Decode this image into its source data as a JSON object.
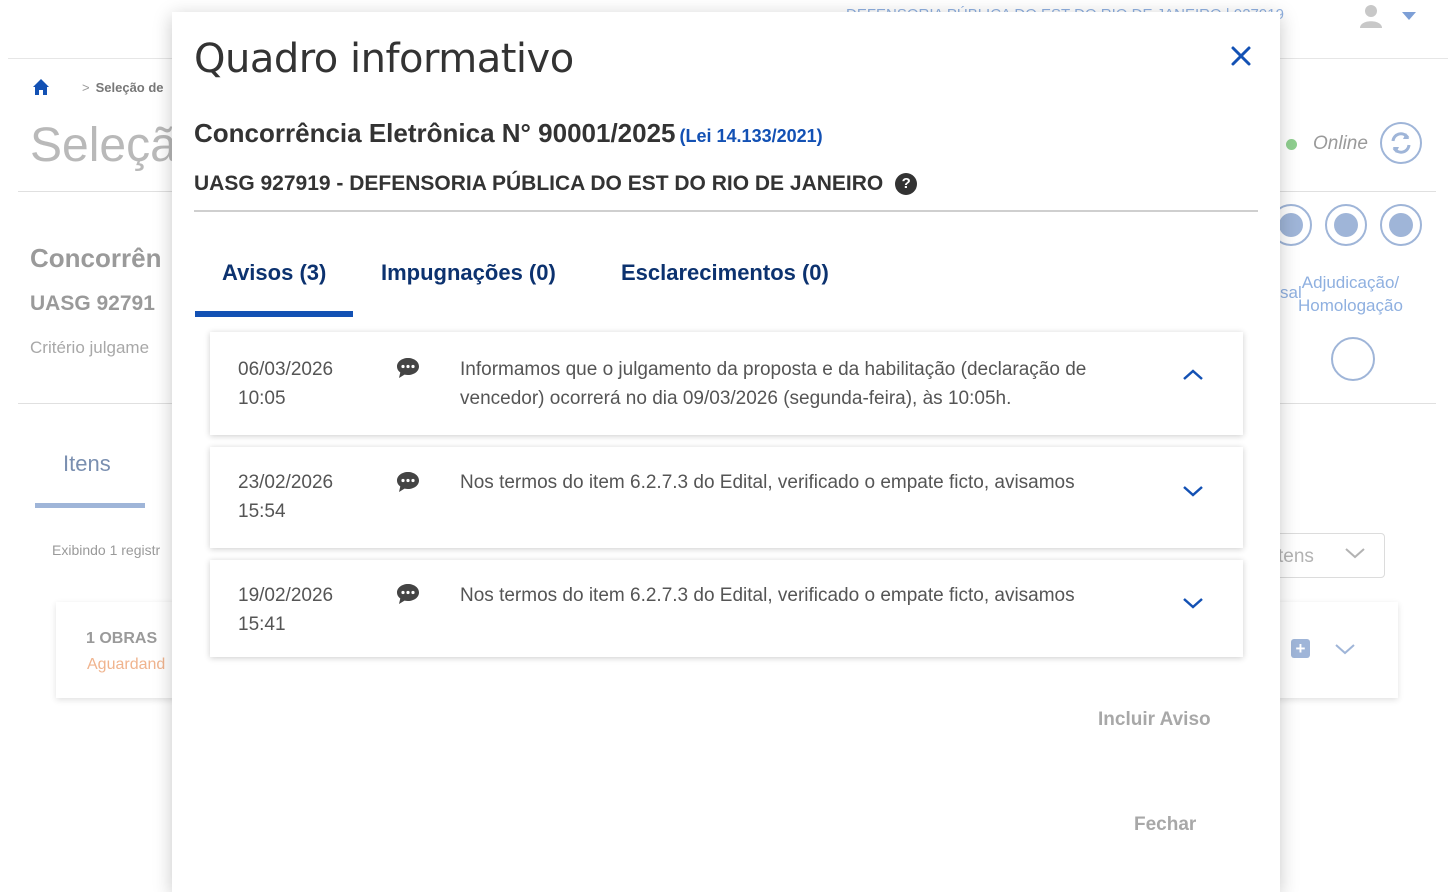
{
  "background": {
    "org_label": "DEFENSORIA PÚBLICA DO EST DO RIO DE JANEIRO | 927919",
    "breadcrumb": "Seleção de",
    "page_title": "Seleçã",
    "concorrencia": "Concorrên",
    "uasg": "UASG 92791",
    "criterio": "Critério julgame",
    "tab_itens": "Itens",
    "exibindo": "Exibindo 1 registr",
    "item_row": "1   OBRAS",
    "item_status": "Aguardand",
    "online_label": "Online",
    "adjudicacao_line1": "Adjudicação/",
    "adjudicacao_line2": "Homologação",
    "sal_fragment": "sal",
    "select_text": "tens"
  },
  "modal": {
    "title": "Quadro informativo",
    "concorrencia": "Concorrência Eletrônica N° 90001/2025",
    "lei": "(Lei 14.133/2021)",
    "uasg": "UASG 927919 - DEFENSORIA PÚBLICA DO EST DO RIO DE JANEIRO",
    "help_glyph": "?",
    "tabs": [
      {
        "label": "Avisos (3)",
        "active": true
      },
      {
        "label": "Impugnações (0)",
        "active": false
      },
      {
        "label": "Esclarecimentos (0)",
        "active": false
      }
    ],
    "avisos": [
      {
        "date": "06/03/2026",
        "time": "10:05",
        "text": "Informamos que o julgamento da proposta e da habilitação (declaração de vencedor) ocorrerá no dia 09/03/2026 (segunda-feira), às 10:05h.",
        "expanded": true
      },
      {
        "date": "23/02/2026",
        "time": "15:54",
        "text": "Nos termos do item 6.2.7.3 do Edital, verificado o empate ficto, avisamos",
        "expanded": false
      },
      {
        "date": "19/02/2026",
        "time": "15:41",
        "text": "Nos termos do item 6.2.7.3 do Edital, verificado o empate ficto, avisamos",
        "expanded": false
      }
    ],
    "incluir_aviso": "Incluir Aviso",
    "fechar": "Fechar"
  },
  "colors": {
    "primary": "#1351b4",
    "dark_blue": "#0c326f",
    "text": "#333333",
    "muted": "#a8a8a8"
  }
}
